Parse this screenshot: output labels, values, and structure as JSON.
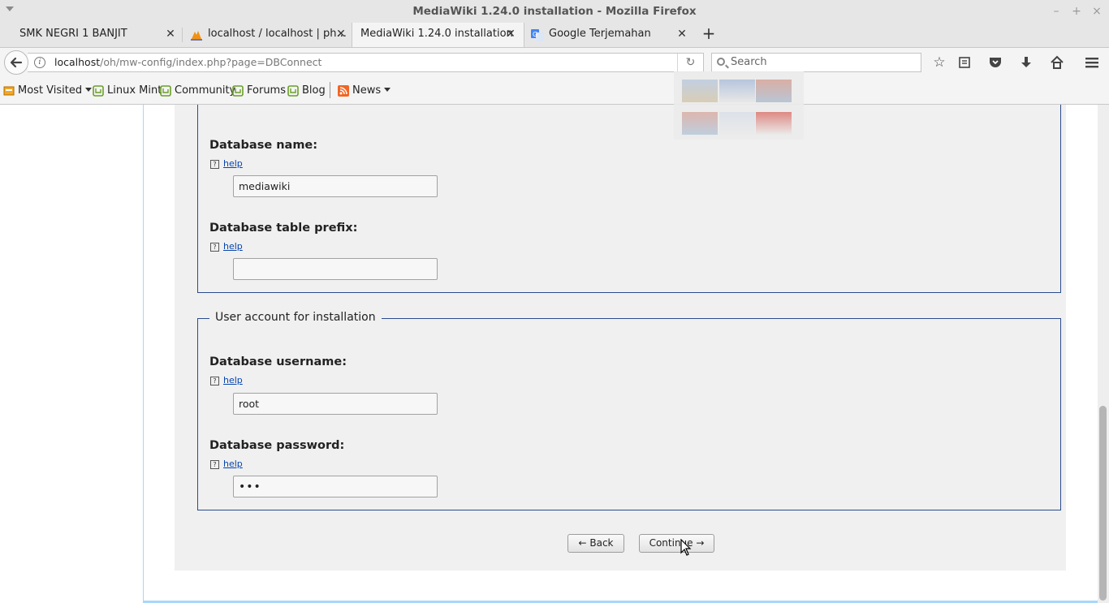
{
  "window": {
    "title": "MediaWiki 1.24.0 installation - Mozilla Firefox",
    "controls": [
      "–",
      "+",
      "×"
    ]
  },
  "tabs": [
    {
      "label": "SMK NEGRI 1 BANJIT",
      "icon": "blank-page-icon",
      "active": false
    },
    {
      "label": "localhost / localhost | ph...",
      "icon": "phpmyadmin-icon",
      "active": false
    },
    {
      "label": "MediaWiki 1.24.0 installation",
      "icon": "",
      "active": true
    },
    {
      "label": "Google Terjemahan",
      "icon": "google-translate-icon",
      "active": false
    }
  ],
  "urlbar": {
    "host": "localhost",
    "path": "/oh/mw-config/index.php?page=DBConnect"
  },
  "search": {
    "placeholder": "Search"
  },
  "bookmarks": [
    {
      "label": "Most Visited",
      "icon": "most-visited-icon",
      "dropdown": true
    },
    {
      "label": "Linux Mint",
      "icon": "mint-icon",
      "dropdown": false
    },
    {
      "label": "Community",
      "icon": "mint-icon",
      "dropdown": false
    },
    {
      "label": "Forums",
      "icon": "mint-icon",
      "dropdown": false
    },
    {
      "label": "Blog",
      "icon": "mint-icon",
      "dropdown": false
    },
    {
      "label": "News",
      "icon": "rss-icon",
      "dropdown": true
    }
  ],
  "form": {
    "db_name_label": "Database name:",
    "db_name_value": "mediawiki",
    "db_prefix_label": "Database table prefix:",
    "db_prefix_value": "",
    "user_account_legend": "User account for installation",
    "db_username_label": "Database username:",
    "db_username_value": "root",
    "db_password_label": "Database password:",
    "db_password_value": "•••",
    "help_label": "help",
    "help_icon": "?"
  },
  "buttons": {
    "back": "← Back",
    "continue": "Continue →"
  },
  "colors": {
    "fieldset_border": "#2a4b8d",
    "link": "#0645ad",
    "panel_bg": "#f0f0f0"
  }
}
